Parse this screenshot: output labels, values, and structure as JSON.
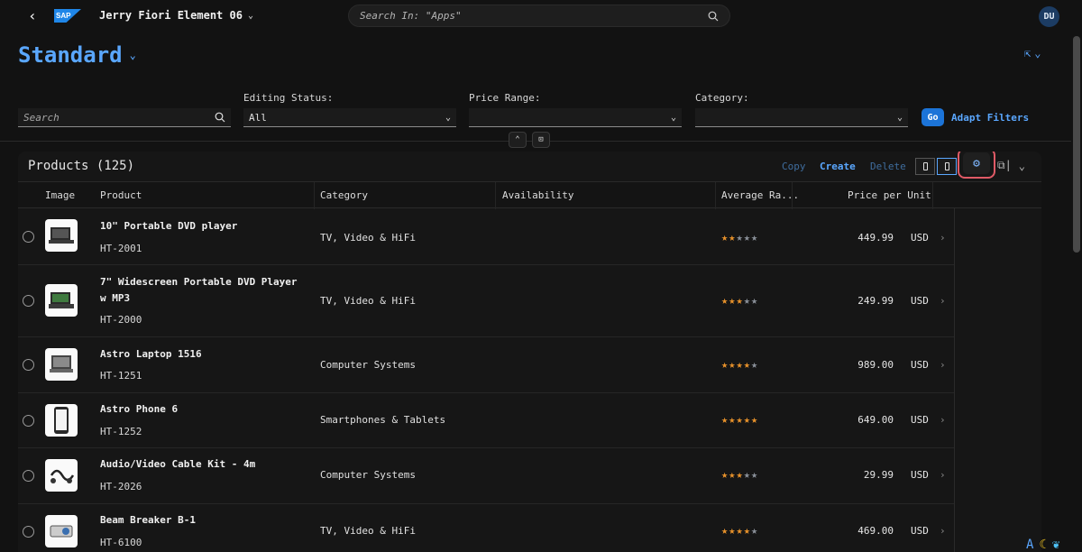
{
  "shell": {
    "title": "Jerry Fiori Element 06",
    "search_placeholder": "Search In: \"Apps\"",
    "avatar": "DU",
    "logo_text": "SAP"
  },
  "variant": {
    "name": "Standard"
  },
  "filters": {
    "search_placeholder": "Search",
    "editing_status": {
      "label": "Editing Status:",
      "value": "All"
    },
    "price_range": {
      "label": "Price Range:",
      "value": ""
    },
    "category": {
      "label": "Category:",
      "value": ""
    },
    "go_label": "Go",
    "adapt_label": "Adapt Filters"
  },
  "table": {
    "title": "Products (125)",
    "actions": {
      "copy": "Copy",
      "create": "Create",
      "delete": "Delete"
    },
    "columns": [
      "Image",
      "Product",
      "Category",
      "Availability",
      "Average Ra...",
      "Price per Unit"
    ],
    "rows": [
      {
        "name": "10\" Portable DVD player",
        "id": "HT-2001",
        "category": "TV, Video & HiFi",
        "rating": 2,
        "price": "449.99",
        "currency": "USD"
      },
      {
        "name": "7\" Widescreen Portable DVD Player w MP3",
        "id": "HT-2000",
        "category": "TV, Video & HiFi",
        "rating": 2.5,
        "price": "249.99",
        "currency": "USD"
      },
      {
        "name": "Astro Laptop 1516",
        "id": "HT-1251",
        "category": "Computer Systems",
        "rating": 3.5,
        "price": "989.00",
        "currency": "USD"
      },
      {
        "name": "Astro Phone 6",
        "id": "HT-1252",
        "category": "Smartphones & Tablets",
        "rating": 4.5,
        "price": "649.00",
        "currency": "USD"
      },
      {
        "name": "Audio/Video Cable Kit - 4m",
        "id": "HT-2026",
        "category": "Computer Systems",
        "rating": 2.5,
        "price": "29.99",
        "currency": "USD"
      },
      {
        "name": "Beam Breaker B-1",
        "id": "HT-6100",
        "category": "TV, Video & HiFi",
        "rating": 3.5,
        "price": "469.00",
        "currency": "USD"
      }
    ]
  },
  "colors": {
    "accent": "#5aa7ff",
    "star": "#e8922b",
    "highlight": "#e05a66"
  }
}
